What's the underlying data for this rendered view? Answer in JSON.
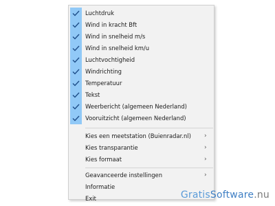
{
  "menu": {
    "checked_items": [
      {
        "label": "Luchtdruk"
      },
      {
        "label": "Wind in kracht Bft"
      },
      {
        "label": "Wind in snelheid m/s"
      },
      {
        "label": "Wind in snelheid km/u"
      },
      {
        "label": "Luchtvochtigheid"
      },
      {
        "label": "Windrichting"
      },
      {
        "label": "Temperatuur"
      },
      {
        "label": "Tekst"
      },
      {
        "label": "Weerbericht (algemeen Nederland)"
      },
      {
        "label": "Vooruitzicht (algemeen Nederland)"
      }
    ],
    "submenu_items": [
      {
        "label": "Kies een meetstation (Buienradar.nl)"
      },
      {
        "label": "Kies transparantie"
      },
      {
        "label": "Kies formaat"
      }
    ],
    "advanced": {
      "label": "Geavanceerde instellingen"
    },
    "info": {
      "label": "Informatie"
    },
    "exit": {
      "label": "Exit"
    },
    "submenu_arrow": "›",
    "check_icon": "checkmark-icon",
    "check_highlight_color": "#91c9f7"
  },
  "watermark": {
    "part1": "Gratis",
    "part2": "Software",
    "part3": ".nu"
  }
}
